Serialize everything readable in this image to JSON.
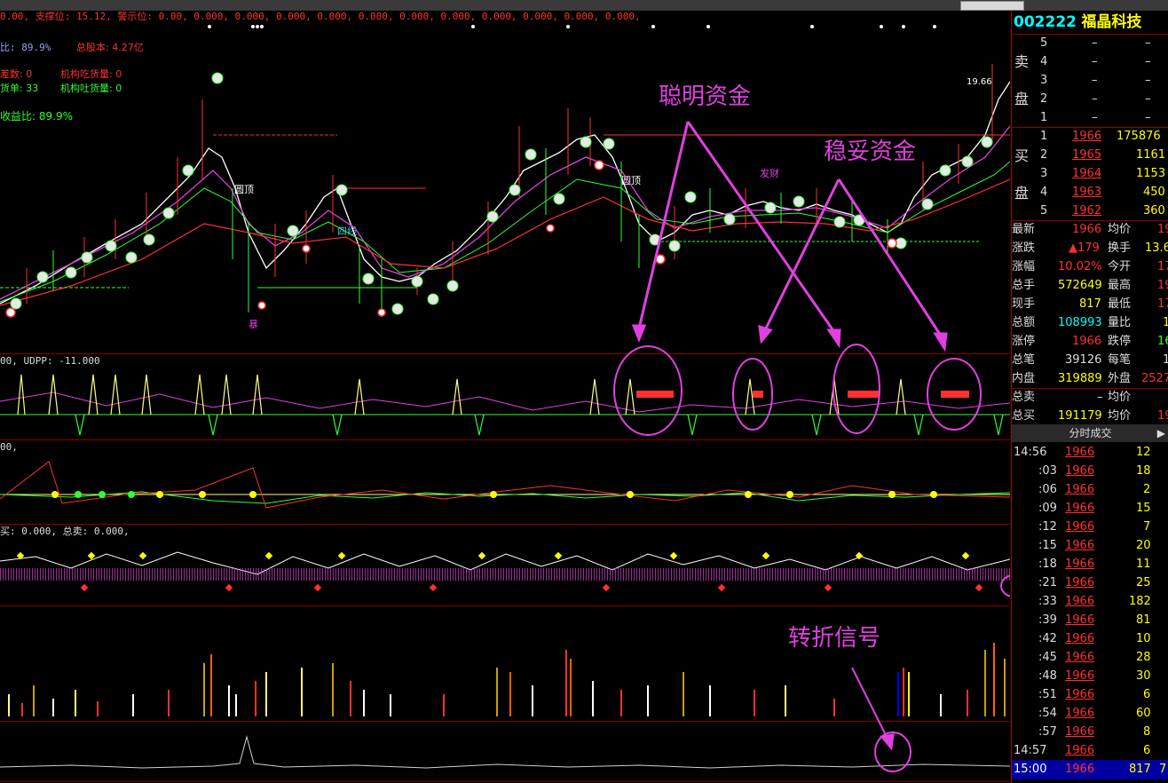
{
  "stock": {
    "code": "002222",
    "name": "福晶科技"
  },
  "overlay_texts": {
    "line1": "0.00, 支撑位: 15.12, 警示位: 0.00, 0.000, 0.000, 0.000, 0.000, 0.000, 0.000, 0.000, 0.000, 0.000, 0.000, 0.000,",
    "line2a": "比: 89.9%",
    "line2b": "总股本: 4.27亿",
    "line3a": "差数: 0",
    "line3b": "机构吃货量: 0",
    "line4a": "货单: 33",
    "line4b": "机构吐货量: 0",
    "line5": "收益比: 89.9%",
    "peak_label": "19.66",
    "sub1_label": "00, UDPP: -11.000",
    "sub2_label": "00,",
    "sub3_label": "买: 0.000, 总卖: 0.000,",
    "wave1": "圆顶",
    "wave2": "圆顶",
    "line_sixi": "四线",
    "baozhang": "暴",
    "shouhuo": "发财"
  },
  "annotations": {
    "smart_money": "聪明资金",
    "stable_money": "稳妥资金",
    "turn_signal": "转折信号"
  },
  "order_book": {
    "sell_label": [
      "卖",
      "盘"
    ],
    "buy_label": [
      "买",
      "盘"
    ],
    "sell": [
      {
        "level": "5",
        "price": "–",
        "vol": "–"
      },
      {
        "level": "4",
        "price": "–",
        "vol": "–"
      },
      {
        "level": "3",
        "price": "–",
        "vol": "–"
      },
      {
        "level": "2",
        "price": "–",
        "vol": "–"
      },
      {
        "level": "1",
        "price": "–",
        "vol": "–"
      }
    ],
    "buy": [
      {
        "level": "1",
        "price": "1966",
        "vol": "175876"
      },
      {
        "level": "2",
        "price": "1965",
        "vol": "1161"
      },
      {
        "level": "3",
        "price": "1964",
        "vol": "1153"
      },
      {
        "level": "4",
        "price": "1963",
        "vol": "450"
      },
      {
        "level": "5",
        "price": "1962",
        "vol": "360"
      }
    ]
  },
  "quote": [
    {
      "l1": "最新",
      "v1": "1966",
      "l2": "均价",
      "v2": "19"
    },
    {
      "l1": "涨跌",
      "v1": "▲179",
      "l2": "换手",
      "v2": "13.6"
    },
    {
      "l1": "涨幅",
      "v1": "10.02%",
      "l2": "今开",
      "v2": "17"
    },
    {
      "l1": "总手",
      "v1": "572649",
      "l2": "最高",
      "v2": "19"
    },
    {
      "l1": "现手",
      "v1": "817",
      "l2": "最低",
      "v2": "17"
    },
    {
      "l1": "总额",
      "v1": "108993",
      "l2": "量比",
      "v2": "1"
    },
    {
      "l1": "涨停",
      "v1": "1966",
      "l2": "跌停",
      "v2": "16"
    },
    {
      "l1": "总笔",
      "v1": "39126",
      "l2": "每笔",
      "v2": "1"
    },
    {
      "l1": "内盘",
      "v1": "319889",
      "l2": "外盘",
      "v2": "2527"
    },
    {
      "l1": "总卖",
      "v1": "–",
      "l2": "均价",
      "v2": ""
    },
    {
      "l1": "总买",
      "v1": "191179",
      "l2": "均价",
      "v2": "19"
    }
  ],
  "ticks_header": "分时成交",
  "ticks": [
    {
      "time": "14:56",
      "price": "1966",
      "vol": "12"
    },
    {
      "time": ":03",
      "price": "1966",
      "vol": "18"
    },
    {
      "time": ":06",
      "price": "1966",
      "vol": "2"
    },
    {
      "time": ":09",
      "price": "1966",
      "vol": "15"
    },
    {
      "time": ":12",
      "price": "1966",
      "vol": "7"
    },
    {
      "time": ":15",
      "price": "1966",
      "vol": "20"
    },
    {
      "time": ":18",
      "price": "1966",
      "vol": "11"
    },
    {
      "time": ":21",
      "price": "1966",
      "vol": "25"
    },
    {
      "time": ":33",
      "price": "1966",
      "vol": "182"
    },
    {
      "time": ":39",
      "price": "1966",
      "vol": "81"
    },
    {
      "time": ":42",
      "price": "1966",
      "vol": "10"
    },
    {
      "time": ":45",
      "price": "1966",
      "vol": "28"
    },
    {
      "time": ":48",
      "price": "1966",
      "vol": "30"
    },
    {
      "time": ":51",
      "price": "1966",
      "vol": "6"
    },
    {
      "time": ":54",
      "price": "1966",
      "vol": "60"
    },
    {
      "time": ":57",
      "price": "1966",
      "vol": "8"
    },
    {
      "time": "14:57",
      "price": "1966",
      "vol": "6"
    },
    {
      "time": "15:00",
      "price": "1966",
      "vol": "817",
      "extra": "7"
    }
  ],
  "colors": {
    "up": "#ff3030",
    "accent": "#e040e0",
    "yellow": "#ffff00",
    "cyan": "#00ffff",
    "panel_line": "#8b0000",
    "highlight": "#0000a0"
  }
}
